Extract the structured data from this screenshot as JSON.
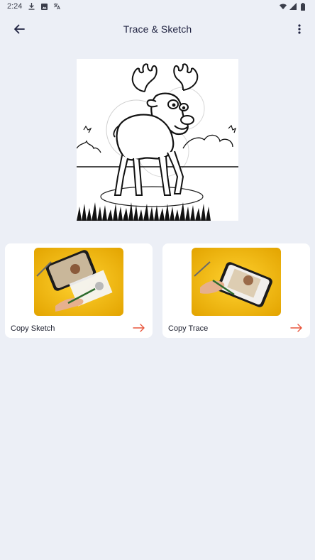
{
  "status_bar": {
    "time": "2:24",
    "left_icons": [
      "download-icon",
      "image-icon",
      "translate-icon"
    ],
    "right_icons": [
      "wifi-icon",
      "signal-icon",
      "battery-icon"
    ]
  },
  "app_bar": {
    "title": "Trace & Sketch",
    "back_icon": "arrow-left-icon",
    "menu_icon": "more-vert-icon"
  },
  "hero": {
    "subject": "moose line drawing"
  },
  "cards": [
    {
      "label": "Copy Sketch",
      "arrow_icon": "arrow-right-icon"
    },
    {
      "label": "Copy Trace",
      "arrow_icon": "arrow-right-icon"
    }
  ],
  "colors": {
    "background": "#eceff6",
    "card": "#ffffff",
    "accent_arrow": "#e8553b",
    "thumb_yellow": "#f2b500"
  }
}
